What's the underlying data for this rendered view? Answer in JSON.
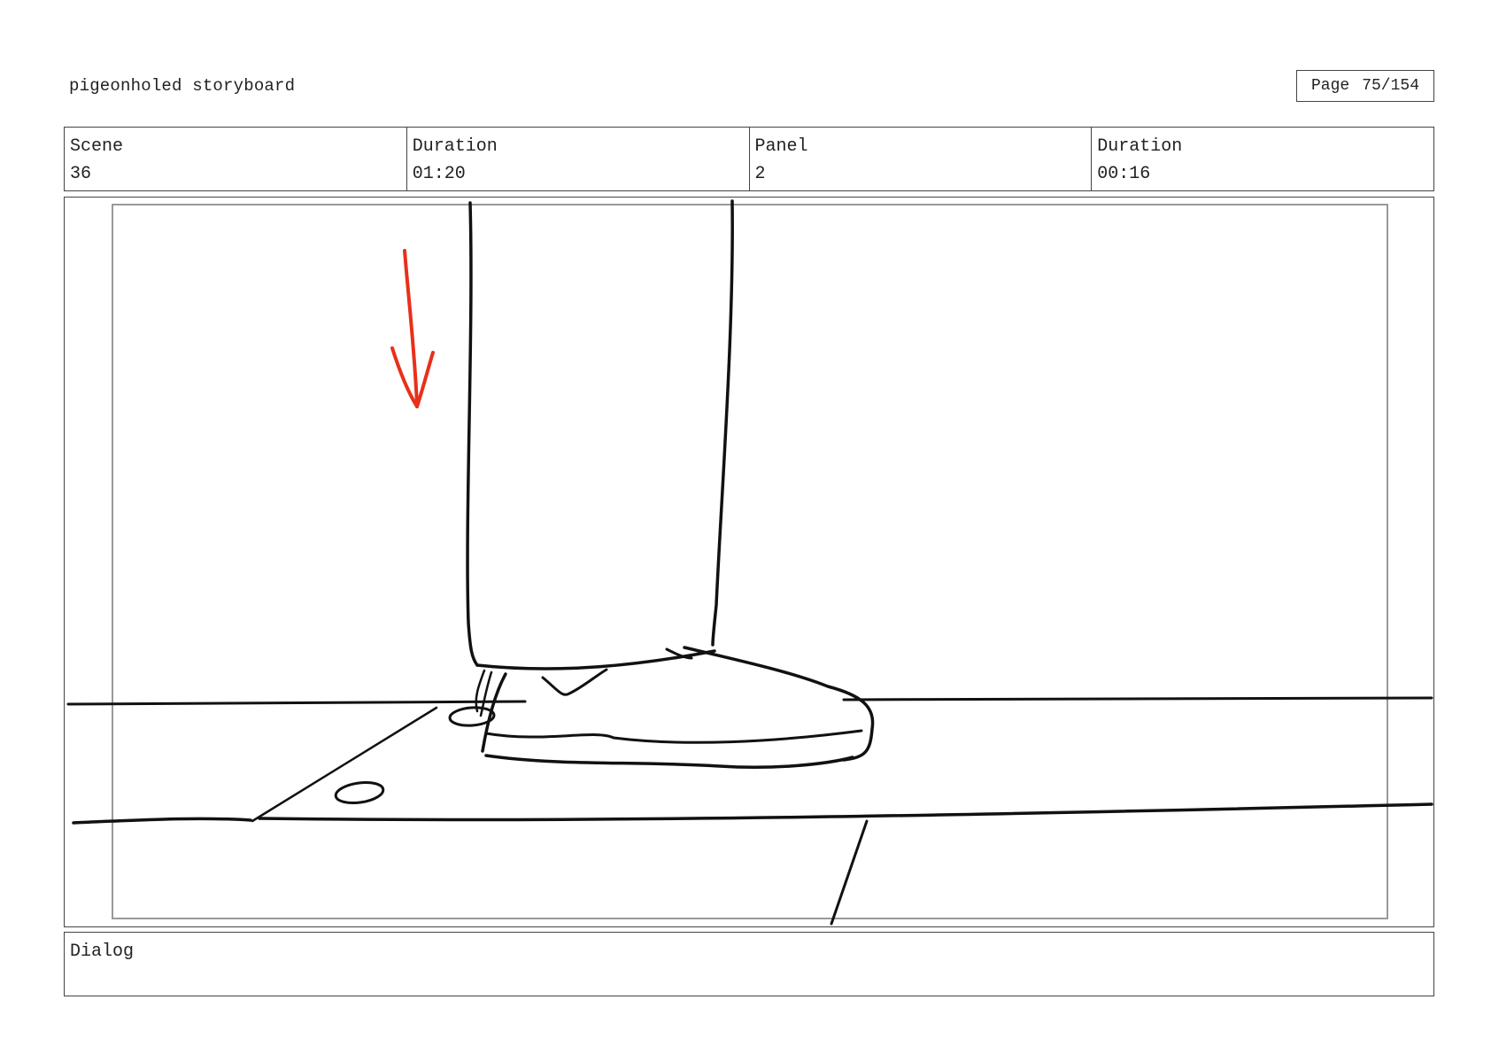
{
  "header": {
    "project_title": "pigeonholed storyboard",
    "page_label": "Page",
    "page_value": "75/154"
  },
  "info": {
    "scene_label": "Scene",
    "scene_value": "36",
    "scene_duration_label": "Duration",
    "scene_duration_value": "01:20",
    "panel_label": "Panel",
    "panel_value": "2",
    "panel_duration_label": "Duration",
    "panel_duration_value": "00:16"
  },
  "dialog": {
    "label": "Dialog",
    "text": ""
  },
  "colors": {
    "ink": "#111111",
    "arrow": "#e8301a",
    "safe_area": "#999999"
  }
}
